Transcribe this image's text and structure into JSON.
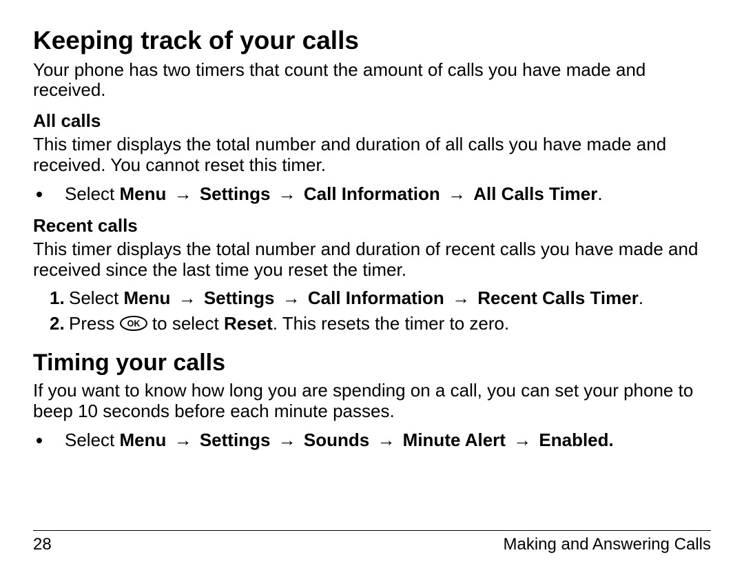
{
  "section1": {
    "title": "Keeping track of your calls",
    "intro": "Your phone has two timers that count the amount of calls you have made and received.",
    "sub1": {
      "heading": "All calls",
      "body": "This timer displays the total number and duration of all calls you have made and received. You cannot reset this timer.",
      "bullet_prefix": "Select ",
      "path": [
        "Menu",
        "Settings",
        "Call Information",
        "All Calls Timer"
      ],
      "bullet_suffix": "."
    },
    "sub2": {
      "heading": "Recent calls",
      "body": "This timer displays the total number and duration of recent calls you have made and received since the last time you reset the timer.",
      "step1_prefix": "Select ",
      "step1_path": [
        "Menu",
        "Settings",
        "Call Information",
        "Recent Calls Timer"
      ],
      "step1_suffix": ".",
      "step2_a": "Press ",
      "step2_b": " to select ",
      "step2_reset": "Reset",
      "step2_c": ". This resets the timer to zero."
    }
  },
  "section2": {
    "title": "Timing your calls",
    "intro": "If you want to know how long you are spending on a call, you can set your phone to beep 10 seconds before each minute passes.",
    "bullet_prefix": "Select ",
    "path": [
      "Menu",
      "Settings",
      "Sounds",
      "Minute Alert",
      "Enabled"
    ],
    "bullet_suffix": "."
  },
  "footer": {
    "page_number": "28",
    "chapter": "Making and Answering Calls"
  },
  "glyphs": {
    "arrow": "→"
  }
}
